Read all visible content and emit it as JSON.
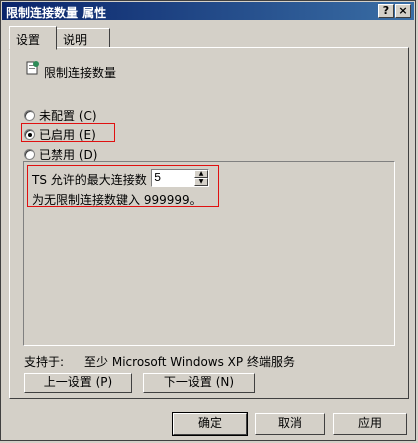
{
  "window": {
    "title": "限制连接数量 属性",
    "help_button": "?",
    "close_button": "×"
  },
  "tabs": [
    {
      "label": "设置"
    },
    {
      "label": "说明"
    }
  ],
  "policy": {
    "name": "限制连接数量"
  },
  "radios": [
    {
      "label": "未配置 (C)",
      "checked": false
    },
    {
      "label": "已启用 (E)",
      "checked": true
    },
    {
      "label": "已禁用 (D)",
      "checked": false
    }
  ],
  "options": {
    "label": "TS 允许的最大连接数",
    "value": "5",
    "hint": "为无限制连接数键入 999999。"
  },
  "supported": {
    "label": "支持于:",
    "value": "至少 Microsoft Windows XP 终端服务"
  },
  "nav": {
    "prev": "上一设置 (P)",
    "next": "下一设置 (N)"
  },
  "buttons": {
    "ok": "确定",
    "cancel": "取消",
    "apply": "应用"
  },
  "colors": {
    "titlebar": "#0a246a",
    "highlight": "#e01010",
    "face": "#d4d0c8"
  }
}
